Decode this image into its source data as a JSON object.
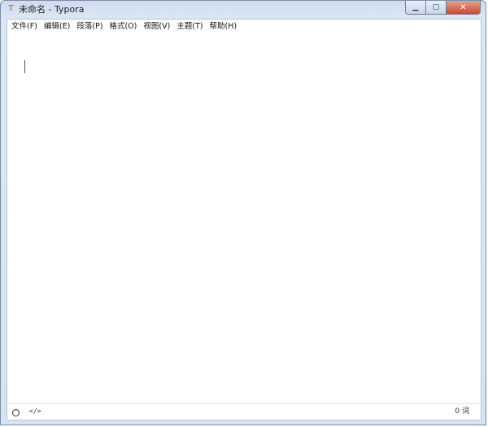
{
  "window": {
    "title": "未命名 - Typora",
    "app_icon_glyph": "T",
    "controls": {
      "minimize_glyph": "▁",
      "maximize_glyph": "▢",
      "close_glyph": "✕"
    }
  },
  "menu": {
    "items": [
      {
        "label": "文件(F)"
      },
      {
        "label": "编辑(E)"
      },
      {
        "label": "段落(P)"
      },
      {
        "label": "格式(O)"
      },
      {
        "label": "视图(V)"
      },
      {
        "label": "主题(T)"
      },
      {
        "label": "帮助(H)"
      }
    ]
  },
  "editor": {
    "content": ""
  },
  "statusbar": {
    "source_mode_glyph": "</>",
    "word_count": "0 词"
  },
  "colors": {
    "close_button": "#c74a35",
    "titlebar": "#dbe7f4",
    "app_icon": "#c0392b"
  }
}
